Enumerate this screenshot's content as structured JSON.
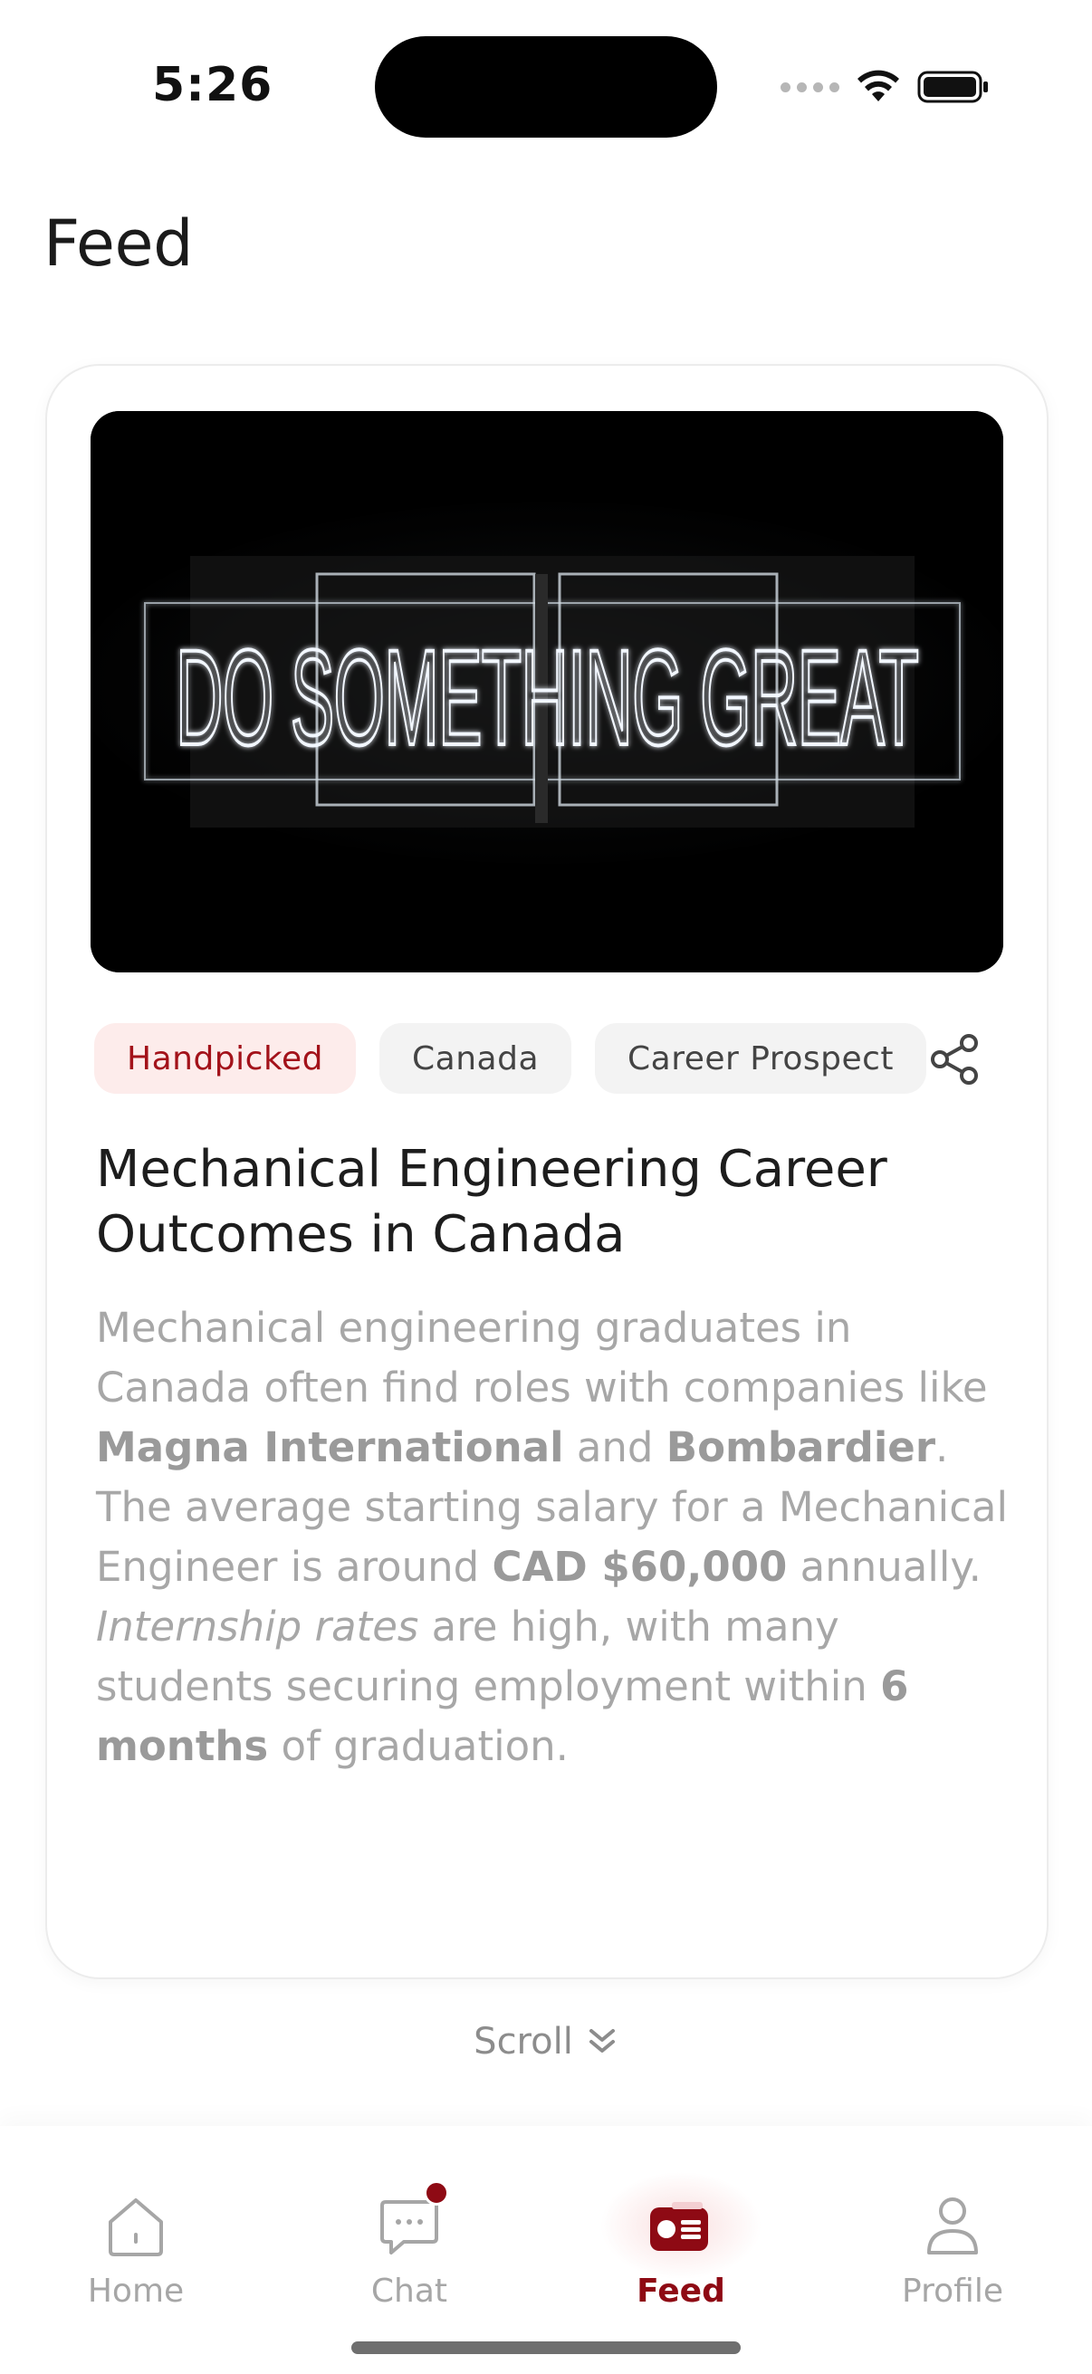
{
  "status_bar": {
    "time": "5:26"
  },
  "header": {
    "title": "Feed"
  },
  "card": {
    "image": {
      "neon_text": "DO SOMETHING GREAT"
    },
    "chips": [
      "Handpicked",
      "Canada",
      "Career Prospect"
    ],
    "title": "Mechanical Engineering Career Outcomes in Canada",
    "body": {
      "p1": "Mechanical engineering graduates in Canada often find roles with companies like ",
      "b1": "Magna International",
      "p2": " and ",
      "b2": "Bombardier",
      "p3": ". The average starting salary for a Mechanical Engineer is around ",
      "b3": "CAD $60,000",
      "p4": " annually. ",
      "i1": "Internship rates",
      "p5": " are high, with many students securing employment within ",
      "b4": "6 months",
      "p6": " of graduation."
    }
  },
  "scroll_hint": "Scroll",
  "tabs": [
    {
      "label": "Home",
      "icon": "home-icon"
    },
    {
      "label": "Chat",
      "icon": "chat-icon",
      "has_badge": true
    },
    {
      "label": "Feed",
      "icon": "feed-icon",
      "active": true
    },
    {
      "label": "Profile",
      "icon": "profile-icon"
    }
  ],
  "colors": {
    "accent": "#8e0a14",
    "chip_accent_bg": "#fdeceb",
    "chip_bg": "#f3f3f3"
  }
}
